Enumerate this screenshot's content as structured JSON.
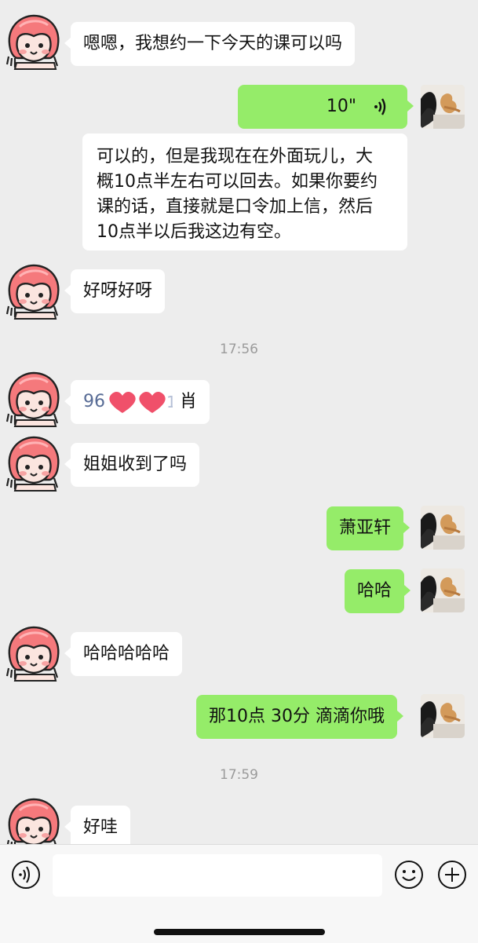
{
  "colors": {
    "background": "#ededed",
    "sent_bubble": "#95ec69",
    "received_bubble": "#ffffff",
    "timestamp": "#9b9b9b",
    "link_blue": "#576b95"
  },
  "messages": [
    {
      "side": "left",
      "text": "嗯嗯，我想约一下今天的课可以吗"
    },
    {
      "side": "right",
      "type": "voice",
      "duration": "10\""
    },
    {
      "side": "left",
      "text_lines": [
        "可以的，但是我现在在外面玩儿，大",
        "概10点半左右可以回去。如果你要约",
        "课的话，直接就是口令加上信，然后",
        "10点半以后我这边有空。"
      ]
    },
    {
      "side": "left",
      "text": "好呀好呀"
    },
    {
      "type": "time",
      "text": "17:56"
    },
    {
      "side": "left",
      "prefix": "96",
      "hidden_part": "redacted-hearts",
      "suffix_faint": "1",
      "suffix": "肖"
    },
    {
      "side": "left",
      "text": "姐姐收到了吗"
    },
    {
      "side": "right",
      "text": "萧亚轩"
    },
    {
      "side": "right",
      "text": "哈哈"
    },
    {
      "side": "left",
      "text": "哈哈哈哈哈"
    },
    {
      "side": "right",
      "text": "那10点 30分 滴滴你哦"
    },
    {
      "type": "time",
      "text": "17:59"
    },
    {
      "side": "left",
      "text": "好哇"
    }
  ],
  "input_bar": {
    "voice_icon": "voice-wave-icon",
    "emoji_icon": "smiley-icon",
    "more_icon": "plus-icon",
    "input_value": ""
  }
}
